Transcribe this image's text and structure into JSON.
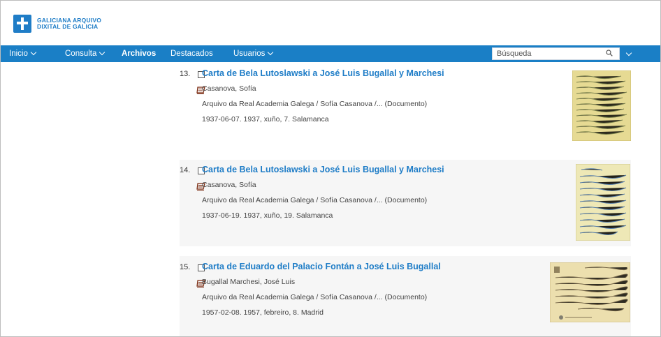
{
  "header": {
    "logo_line1": "GALICIANA ARQUIVO",
    "logo_line2": "DIXITAL DE GALICIA"
  },
  "nav": {
    "items": [
      {
        "label": "Inicio",
        "dropdown": true
      },
      {
        "label": "Consulta",
        "dropdown": true
      },
      {
        "label": "Archivos",
        "dropdown": false
      },
      {
        "label": "Destacados",
        "dropdown": false
      },
      {
        "label": "Usuarios",
        "dropdown": true
      }
    ],
    "search_placeholder": "Búsqueda"
  },
  "results": [
    {
      "number": "13.",
      "title": "Carta de Bela Lutoslawski a José Luis Bugallal y Marchesi",
      "author": "Casanova, Sofía",
      "source": "Arquivo da Real Academia Galega  /  Sofía Casanova  /...  (Documento)",
      "date": "1937-06-07. 1937, xuño, 7. Salamanca"
    },
    {
      "number": "14.",
      "title": "Carta de Bela Lutoslawski a José Luis Bugallal y Marchesi",
      "author": "Casanova, Sofía",
      "source": "Arquivo da Real Academia Galega  /  Sofía Casanova  /...  (Documento)",
      "date": "1937-06-19. 1937, xuño, 19. Salamanca"
    },
    {
      "number": "15.",
      "title": "Carta de Eduardo del Palacio Fontán a José Luis Bugallal",
      "author": "Bugallal Marchesi, José Luis",
      "source": "Arquivo da Real Academia Galega  /  Sofía Casanova  /...  (Documento)",
      "date": "1957-02-08. 1957, febreiro, 8. Madrid"
    }
  ],
  "colors": {
    "brand": "#1a7fc6",
    "link": "#1f7dc7",
    "paper_yellow": "#e8dc9a"
  }
}
